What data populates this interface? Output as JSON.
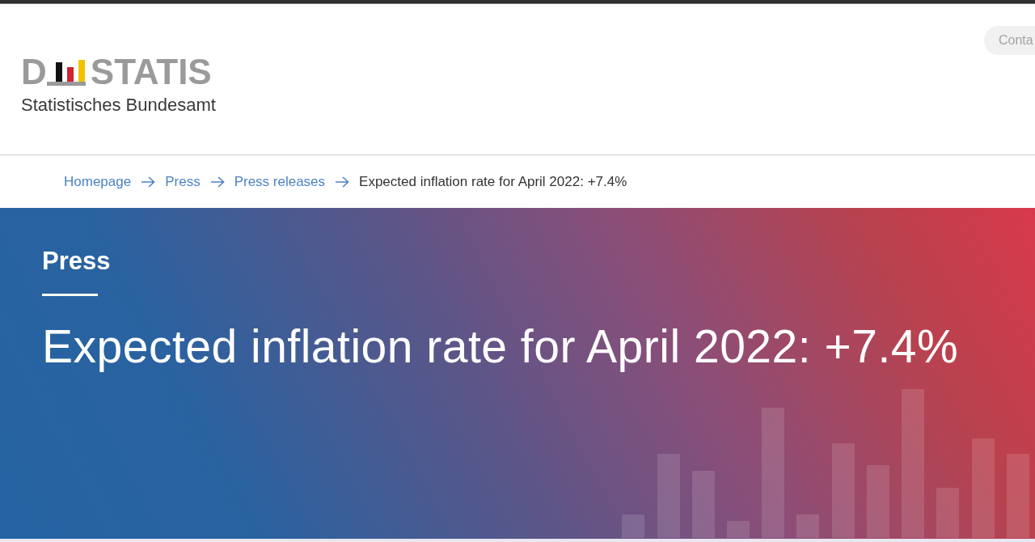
{
  "header": {
    "logo": {
      "text_start": "D",
      "text_end": "STATIS",
      "subtitle": "Statistisches Bundesamt"
    },
    "contact_button": "Conta"
  },
  "breadcrumb": [
    {
      "label": "Homepage",
      "current": false
    },
    {
      "label": "Press",
      "current": false
    },
    {
      "label": "Press releases",
      "current": false
    },
    {
      "label": "Expected inflation rate for April 2022: +7.4%",
      "current": true
    }
  ],
  "hero": {
    "section_label": "Press",
    "title": "Expected inflation rate for April 2022: +7.4%"
  }
}
